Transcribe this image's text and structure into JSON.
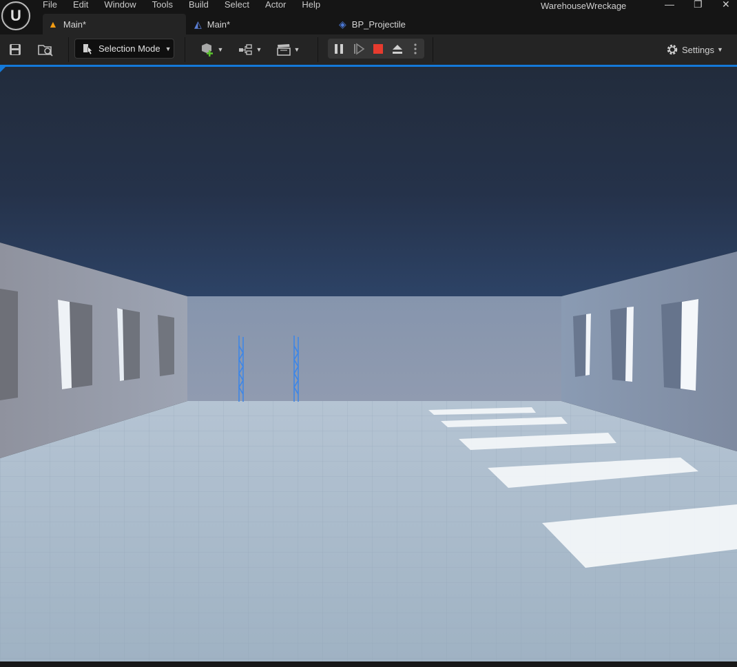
{
  "app": {
    "project_title": "WarehouseWreckage",
    "logo_letter": "U"
  },
  "menu": {
    "items": [
      "File",
      "Edit",
      "Window",
      "Tools",
      "Build",
      "Select",
      "Actor",
      "Help"
    ]
  },
  "window_controls": {
    "minimize": "—",
    "restore": "❐",
    "close": "✕"
  },
  "tabs": [
    {
      "label": "Main*",
      "icon": "level-icon"
    },
    {
      "label": "Main*",
      "icon": "level-blueprint-icon"
    },
    {
      "label": "BP_Projectile",
      "icon": "blueprint-icon"
    }
  ],
  "toolbar": {
    "mode_label": "Selection Mode",
    "settings_label": "Settings"
  },
  "colors": {
    "accent": "#1479d9",
    "active_tab_icon": "#f39c12",
    "stop_button": "#e63b2e",
    "add_green": "#5cc72e"
  }
}
